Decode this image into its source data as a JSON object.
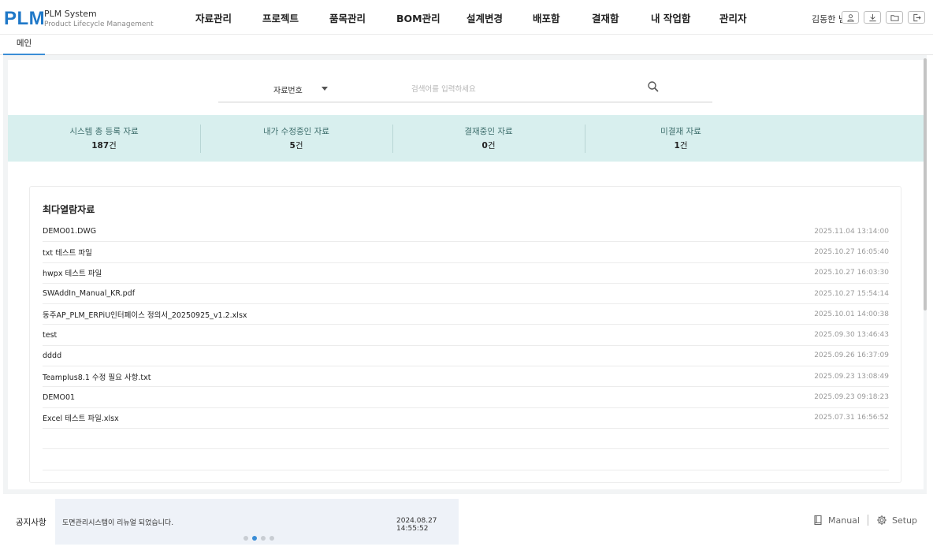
{
  "app": {
    "logo": "PLM",
    "title": "PLM System",
    "subtitle": "Product Lifecycle Management"
  },
  "nav": [
    {
      "label": "자료관리"
    },
    {
      "label": "프로젝트"
    },
    {
      "label": "품목관리"
    },
    {
      "label": "BOM관리"
    },
    {
      "label": "설계변경"
    },
    {
      "label": "배포함"
    },
    {
      "label": "결재함"
    },
    {
      "label": "내 작업함"
    },
    {
      "label": "관리자"
    }
  ],
  "user": {
    "greeting": "김동한 님"
  },
  "header_icons": [
    "user-icon",
    "download-icon",
    "folder-icon",
    "logout-icon"
  ],
  "tabs": [
    {
      "label": "메인",
      "active": true
    }
  ],
  "search": {
    "select_value": "자료번호",
    "placeholder": "검색어를 입력하세요",
    "value": ""
  },
  "stats": [
    {
      "label": "시스템 총 등록 자료",
      "value": "187",
      "unit": "건"
    },
    {
      "label": "내가 수정중인 자료",
      "value": "5",
      "unit": "건"
    },
    {
      "label": "결재중인 자료",
      "value": "0",
      "unit": "건"
    },
    {
      "label": "미결재 자료",
      "value": "1",
      "unit": "건"
    }
  ],
  "recent": {
    "title": "최다열람자료",
    "items": [
      {
        "name": "DEMO01.DWG",
        "time": "2025.11.04 13:14:00"
      },
      {
        "name": "txt 테스트 파일",
        "time": "2025.10.27 16:05:40"
      },
      {
        "name": "hwpx 테스트 파일",
        "time": "2025.10.27 16:03:30"
      },
      {
        "name": "SWAddIn_Manual_KR.pdf",
        "time": "2025.10.27 15:54:14"
      },
      {
        "name": "동주AP_PLM_ERPiU인터페이스 정의서_20250925_v1.2.xlsx",
        "time": "2025.10.01 14:00:38"
      },
      {
        "name": "test",
        "time": "2025.09.30 13:46:43"
      },
      {
        "name": "dddd",
        "time": "2025.09.26 16:37:09"
      },
      {
        "name": "Teamplus8.1 수정 필요 사항.txt",
        "time": "2025.09.23 13:08:49"
      },
      {
        "name": "DEMO01",
        "time": "2025.09.23 09:18:23"
      },
      {
        "name": "Excel 테스트 파일.xlsx",
        "time": "2025.07.31 16:56:52"
      },
      {
        "name": "",
        "time": ""
      },
      {
        "name": "",
        "time": ""
      }
    ]
  },
  "notice": {
    "label": "공지사항",
    "text": "도면관리시스템이 리뉴얼 되었습니다.",
    "time": "2024.08.27 14:55:52",
    "page_count": 4,
    "active_page": 2
  },
  "footer_links": [
    {
      "label": "Manual",
      "icon": "book-icon"
    },
    {
      "label": "Setup",
      "icon": "gear-icon"
    }
  ],
  "colors": {
    "brand": "#1f78c8",
    "stats_bg": "#d8efee",
    "active_tab": "#3a8dd6"
  }
}
